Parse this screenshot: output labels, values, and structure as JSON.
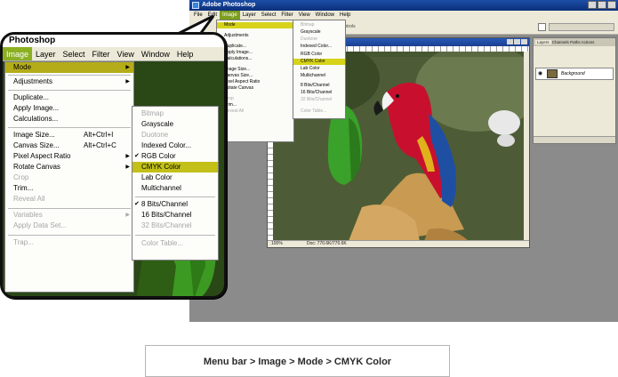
{
  "ps": {
    "title": "Adobe Photoshop",
    "menubar": [
      "File",
      "Edit",
      "Image",
      "Layer",
      "Select",
      "Filter",
      "View",
      "Window",
      "Help"
    ],
    "active_menu": "Image",
    "options_label": "Controls",
    "image_menu": [
      "Mode",
      "Adjustments",
      "Duplicate...",
      "Apply Image...",
      "Calculations...",
      "Image Size...",
      "Canvas Size...",
      "Pixel Aspect Ratio",
      "Rotate Canvas",
      "Crop",
      "Trim...",
      "Reveal All"
    ],
    "mode_menu": [
      "Bitmap",
      "Grayscale",
      "Duotone",
      "Indexed Color...",
      "RGB Color",
      "CMYK Color",
      "Lab Color",
      "Multichannel",
      "8 Bits/Channel",
      "16 Bits/Channel",
      "32 Bits/Channel",
      "Color Table..."
    ],
    "status": {
      "zoom": "100%",
      "doc_size": "Doc: 770.6K/770.6K"
    },
    "layers": {
      "tabs": [
        "Layers",
        "Channels",
        "Paths",
        "Actions"
      ],
      "layer_name": "Background"
    }
  },
  "callout": {
    "title": "Photoshop",
    "menubar": [
      "Image",
      "Layer",
      "Select",
      "Filter",
      "View",
      "Window",
      "Help"
    ],
    "active_menu": "Image",
    "image_menu": [
      {
        "label": "Mode",
        "submenu": true,
        "highlighted": true
      },
      {
        "label": "Adjustments",
        "submenu": true
      },
      {
        "label": "Duplicate..."
      },
      {
        "label": "Apply Image..."
      },
      {
        "label": "Calculations..."
      },
      {
        "label": "Image Size...",
        "shortcut": "Alt+Ctrl+I"
      },
      {
        "label": "Canvas Size...",
        "shortcut": "Alt+Ctrl+C"
      },
      {
        "label": "Pixel Aspect Ratio",
        "submenu": true
      },
      {
        "label": "Rotate Canvas",
        "submenu": true
      },
      {
        "label": "Crop",
        "disabled": true
      },
      {
        "label": "Trim..."
      },
      {
        "label": "Reveal All",
        "disabled": true
      },
      {
        "label": "Variables",
        "submenu": true,
        "disabled": true
      },
      {
        "label": "Apply Data Set...",
        "disabled": true
      },
      {
        "label": "Trap...",
        "disabled": true
      }
    ],
    "mode_menu": [
      {
        "label": "Bitmap",
        "disabled": true
      },
      {
        "label": "Grayscale"
      },
      {
        "label": "Duotone",
        "disabled": true
      },
      {
        "label": "Indexed Color..."
      },
      {
        "label": "RGB Color",
        "checked": true
      },
      {
        "label": "CMYK Color",
        "highlighted": true
      },
      {
        "label": "Lab Color"
      },
      {
        "label": "Multichannel"
      },
      {
        "label": "8 Bits/Channel",
        "checked": true
      },
      {
        "label": "16 Bits/Channel"
      },
      {
        "label": "32 Bits/Channel",
        "disabled": true
      },
      {
        "label": "Color Table...",
        "disabled": true
      }
    ]
  },
  "caption": "Menu bar > Image > Mode > CMYK Color",
  "colors": {
    "menu_highlight": "#b4ad19",
    "titlebar_blue": "#1c4ea8",
    "parrot_red": "#c8102e",
    "parrot_green": "#2f8a1e"
  }
}
